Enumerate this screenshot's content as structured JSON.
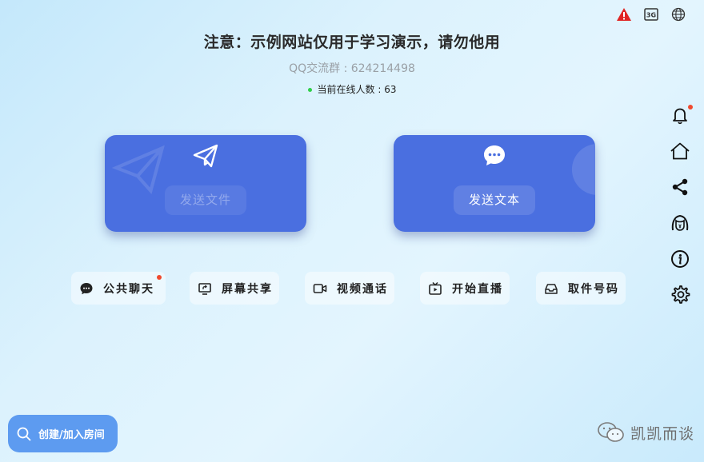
{
  "header": {
    "notice": "注意：示例网站仅用于学习演示，请勿他用",
    "qq_group": "QQ交流群 : 624214498",
    "online_count": "当前在线人数 : 63"
  },
  "top_status": {
    "icons": [
      "warning-icon",
      "network-3g-icon",
      "globe-icon"
    ],
    "network_label": "3G",
    "warning_color": "#e02424"
  },
  "cards": {
    "send_file": {
      "label": "发送文件",
      "icon": "paper-plane-icon"
    },
    "send_text": {
      "label": "发送文本",
      "icon": "chat-bubble-icon"
    }
  },
  "actions": {
    "public_chat": {
      "label": "公共聊天",
      "icon": "chat-icon",
      "has_badge": true
    },
    "screen_share": {
      "label": "屏幕共享",
      "icon": "screen-share-icon"
    },
    "video_call": {
      "label": "视频通话",
      "icon": "video-camera-icon"
    },
    "live_stream": {
      "label": "开始直播",
      "icon": "tv-icon"
    },
    "pickup_code": {
      "label": "取件号码",
      "icon": "inbox-icon"
    }
  },
  "sidebar": {
    "items": [
      "bell-icon",
      "home-icon",
      "share-icon",
      "avatar-icon",
      "info-icon",
      "gear-icon"
    ],
    "bell_has_badge": true
  },
  "room_button": {
    "label": "创建/加入房间",
    "icon": "search-icon"
  },
  "watermark": {
    "text": "凯凯而谈",
    "icon": "wechat-icon"
  },
  "colors": {
    "accent_card": "#4a6fe0",
    "badge_red": "#f0492e",
    "online_green": "#2fcf4a",
    "room_button": "#5d9bf0"
  }
}
